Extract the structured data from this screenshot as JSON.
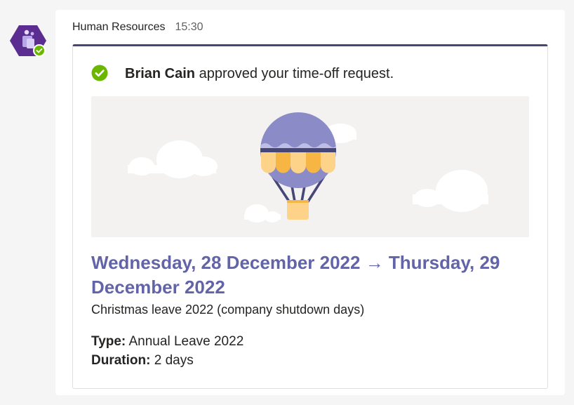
{
  "message": {
    "sender": "Human Resources",
    "time": "15:30"
  },
  "card": {
    "approver": "Brian Cain",
    "approved_text": "approved your time-off request.",
    "date_range": "Wednesday, 28 December 2022 → Thursday, 29 December 2022",
    "description": "Christmas leave 2022 (company shutdown days)",
    "type_label": "Type:",
    "type_value": "Annual Leave 2022",
    "duration_label": "Duration:",
    "duration_value": "2 days"
  },
  "icons": {
    "avatar": "teams-app-icon",
    "status": "available-status-icon",
    "approved": "check-circle-icon",
    "hero": "hot-air-balloon-illustration"
  },
  "colors": {
    "brand": "#6264a7",
    "card_accent": "#464775",
    "approved_green": "#6bb700",
    "background": "#f5f5f5"
  }
}
